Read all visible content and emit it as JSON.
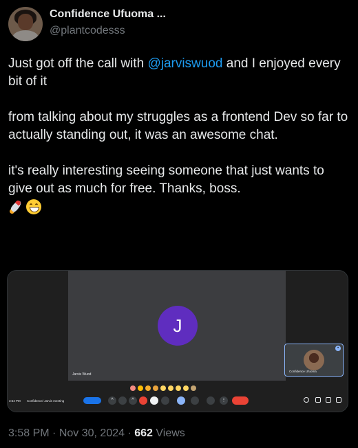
{
  "author": {
    "display_name": "Confidence Ufuoma ...",
    "handle": "@plantcodesss"
  },
  "tweet": {
    "line1_pre": "Just got off the call with ",
    "mention": "@jarviswuod",
    "line1_post": " and I enjoyed every bit of it",
    "para2": "from talking about my struggles as a frontend Dev so far to actually standing out, it was an awesome chat.",
    "para3": "it's really interesting seeing someone that just wants to give out as much for free. Thanks, boss.",
    "emojis": [
      "rocket-emoji",
      "grinning-face-emoji"
    ]
  },
  "media": {
    "main_tile": {
      "initial": "J",
      "name": "Jarvis Wuod"
    },
    "self_tile": {
      "name": "Confidence Ufuoma"
    },
    "bar": {
      "time": "3:54 PM",
      "meeting_title": "Confidence/ Jarvis meeting"
    },
    "colors": {
      "avatar_purple": "#5f2dbf",
      "end_call_red": "#ea4335",
      "active_blue": "#8ab4f8"
    }
  },
  "meta": {
    "time": "3:58 PM",
    "separator": "·",
    "date": "Nov 30, 2024",
    "views_count": "662",
    "views_label": "Views"
  }
}
